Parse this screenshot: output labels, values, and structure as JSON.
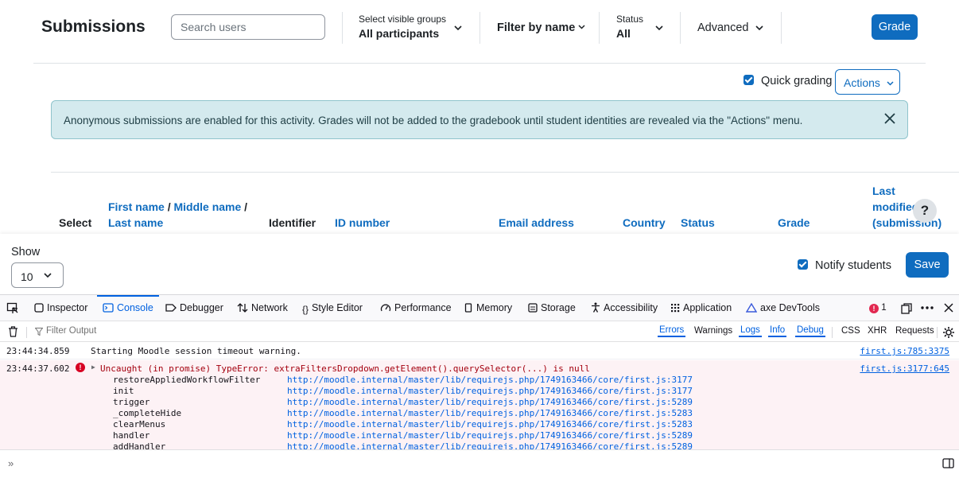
{
  "header": {
    "title": "Submissions",
    "search_placeholder": "Search users",
    "groups_label": "Select visible groups",
    "groups_value": "All participants",
    "filter_by_name": "Filter by name",
    "status_label": "Status",
    "status_value": "All",
    "advanced": "Advanced",
    "grade_button": "Grade"
  },
  "options": {
    "quick_grading": "Quick grading",
    "actions": "Actions"
  },
  "alert": {
    "text": "Anonymous submissions are enabled for this activity. Grades will not be added to the gradebook until student identities are revealed via the \"Actions\" menu."
  },
  "table": {
    "headers": {
      "select": "Select",
      "first_name": "First name",
      "middle_name": "Middle name",
      "last_name": "Last name",
      "sep": "/",
      "identifier": "Identifier",
      "id_number": "ID number",
      "email": "Email address",
      "country": "Country",
      "status": "Status",
      "grade": "Grade",
      "last_modified_1": "Last",
      "last_modified_2": "modified",
      "last_modified_3": "(submission)"
    },
    "help": "?"
  },
  "footer": {
    "show_label": "Show",
    "show_value": "10",
    "notify": "Notify students",
    "save": "Save"
  },
  "devtools": {
    "tabs": [
      "Inspector",
      "Console",
      "Debugger",
      "Network",
      "Style Editor",
      "Performance",
      "Memory",
      "Storage",
      "Accessibility",
      "Application",
      "axe DevTools"
    ],
    "active_tab": "Console",
    "error_count": "1",
    "filter_placeholder": "Filter Output",
    "levels": [
      "Errors",
      "Warnings",
      "Logs",
      "Info",
      "Debug"
    ],
    "extras": [
      "CSS",
      "XHR",
      "Requests"
    ],
    "logs": [
      {
        "time": "23:44:34.859",
        "message": "Starting Moodle session timeout warning.",
        "source": "first.js:785:3375"
      },
      {
        "time": "23:44:37.602",
        "message": "Uncaught (in promise) TypeError: extraFiltersDropdown.getElement().querySelector(...) is null",
        "source": "first.js:3177:645"
      }
    ],
    "stack": [
      {
        "fn": "restoreAppliedWorkflowFilter",
        "url": "http://moodle.internal/master/lib/requirejs.php/1749163466/core/first.js:3177"
      },
      {
        "fn": "init",
        "url": "http://moodle.internal/master/lib/requirejs.php/1749163466/core/first.js:3177"
      },
      {
        "fn": "trigger",
        "url": "http://moodle.internal/master/lib/requirejs.php/1749163466/core/first.js:5289"
      },
      {
        "fn": "_completeHide",
        "url": "http://moodle.internal/master/lib/requirejs.php/1749163466/core/first.js:5283"
      },
      {
        "fn": "clearMenus",
        "url": "http://moodle.internal/master/lib/requirejs.php/1749163466/core/first.js:5283"
      },
      {
        "fn": "handler",
        "url": "http://moodle.internal/master/lib/requirejs.php/1749163466/core/first.js:5289"
      },
      {
        "fn": "addHandler",
        "url": "http://moodle.internal/master/lib/requirejs.php/1749163466/core/first.js:5289"
      }
    ],
    "prompt": "»"
  }
}
